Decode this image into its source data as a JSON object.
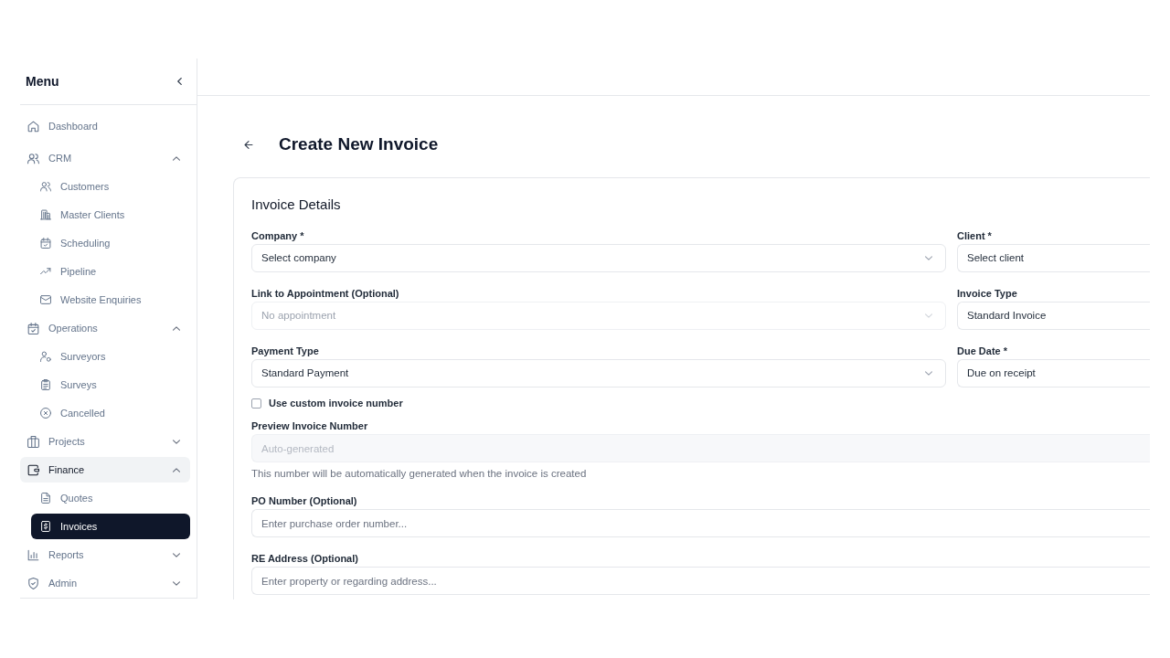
{
  "sidebar": {
    "title": "Menu",
    "items": [
      {
        "label": "Dashboard",
        "selected": false
      },
      {
        "label": "CRM",
        "selected": false,
        "expanded": true,
        "children": [
          {
            "label": "Customers",
            "selected": false
          },
          {
            "label": "Master Clients",
            "selected": false
          },
          {
            "label": "Scheduling",
            "selected": false
          },
          {
            "label": "Pipeline",
            "selected": false
          },
          {
            "label": "Website Enquiries",
            "selected": false
          }
        ]
      },
      {
        "label": "Operations",
        "selected": false,
        "expanded": true,
        "children": [
          {
            "label": "Surveyors",
            "selected": false
          },
          {
            "label": "Surveys",
            "selected": false
          },
          {
            "label": "Cancelled",
            "selected": false
          }
        ]
      },
      {
        "label": "Projects",
        "selected": false,
        "expanded": false
      },
      {
        "label": "Finance",
        "selected": true,
        "expanded": true,
        "children": [
          {
            "label": "Quotes",
            "selected": false
          },
          {
            "label": "Invoices",
            "selected": true
          }
        ]
      },
      {
        "label": "Reports",
        "selected": false,
        "expanded": false
      },
      {
        "label": "Admin",
        "selected": false,
        "expanded": false
      }
    ]
  },
  "page": {
    "title": "Create New Invoice"
  },
  "card": {
    "title": "Invoice Details",
    "field_grid": [
      {
        "kind": "select",
        "label": "Company *",
        "placeholder": "Select company",
        "disabled": false
      },
      {
        "kind": "field",
        "label": "Client *",
        "placeholder": "Select client",
        "disabled": false
      },
      {
        "kind": "select",
        "label": "Link to Appointment (Optional)",
        "placeholder": "No appointment",
        "disabled": true
      },
      {
        "kind": "field",
        "label": "Invoice Type",
        "value": "Standard Invoice",
        "disabled": false
      },
      {
        "kind": "select",
        "label": "Payment Type",
        "value": "Standard Payment",
        "disabled": false
      },
      {
        "kind": "field",
        "label": "Due Date *",
        "value": "Due on receipt",
        "disabled": false
      }
    ],
    "fields": [
      {
        "kind": "checkbox",
        "label": "Use custom invoice number",
        "checked": false
      },
      {
        "kind": "input",
        "label": "Preview Invoice Number",
        "placeholder": "Auto-generated",
        "disabled": true,
        "help": "This number will be automatically generated when the invoice is created"
      },
      {
        "kind": "input",
        "label": "PO Number (Optional)",
        "placeholder": "Enter purchase order number...",
        "disabled": false
      },
      {
        "kind": "input",
        "label": "RE Address (Optional)",
        "placeholder": "Enter property or regarding address...",
        "disabled": false
      }
    ]
  }
}
